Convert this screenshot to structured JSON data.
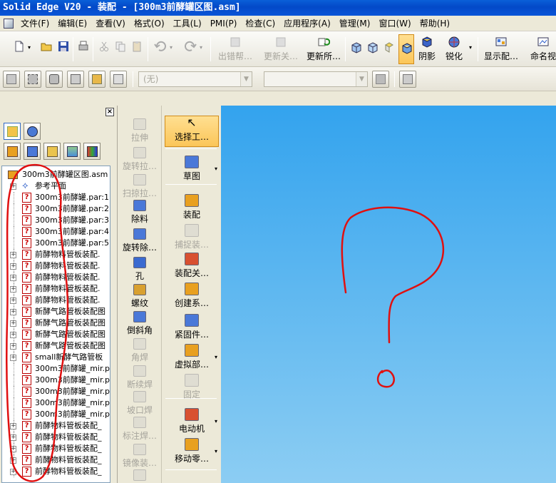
{
  "window": {
    "title": "Solid Edge V20 - 装配 - [300m3前酵罐区图.asm]"
  },
  "menubar": {
    "items": [
      "文件(F)",
      "编辑(E)",
      "查看(V)",
      "格式(O)",
      "工具(L)",
      "PMI(P)",
      "检查(C)",
      "应用程序(A)",
      "管理(M)",
      "窗口(W)",
      "帮助(H)"
    ]
  },
  "toolbar1": {
    "labels": {
      "error_helper": "出错帮…",
      "update_rel": "更新关…",
      "update_all": "更新所…",
      "shadow": "阴影",
      "sharpen": "锐化",
      "show_config": "显示配…",
      "named_views": "命名视"
    }
  },
  "toolbar2": {
    "style_combo_value": "(无)",
    "second_combo_value": ""
  },
  "left_panel": {
    "tree": [
      {
        "label": "300m3前酵罐区图.asm",
        "type": "root"
      },
      {
        "label": "参考平面",
        "type": "planes",
        "expand": true
      },
      {
        "label": "300m3前酵罐.par:1",
        "type": "part"
      },
      {
        "label": "300m3前酵罐.par:2",
        "type": "part"
      },
      {
        "label": "300m3前酵罐.par:3",
        "type": "part"
      },
      {
        "label": "300m3前酵罐.par:4",
        "type": "part"
      },
      {
        "label": "300m3前酵罐.par:5",
        "type": "part"
      },
      {
        "label": "前酵物料管板装配.",
        "type": "asm",
        "expand": true
      },
      {
        "label": "前酵物料管板装配.",
        "type": "asm",
        "expand": true
      },
      {
        "label": "前酵物料管板装配.",
        "type": "asm",
        "expand": true
      },
      {
        "label": "前酵物料管板装配.",
        "type": "asm",
        "expand": true
      },
      {
        "label": "前酵物料管板装配.",
        "type": "asm",
        "expand": true
      },
      {
        "label": "新酵气路管板装配图",
        "type": "asm",
        "expand": true
      },
      {
        "label": "新酵气路管板装配图",
        "type": "asm",
        "expand": true
      },
      {
        "label": "新酵气路管板装配图",
        "type": "asm",
        "expand": true
      },
      {
        "label": "新酵气路管板装配图",
        "type": "asm",
        "expand": true
      },
      {
        "label": "small新酵气路管板",
        "type": "asm",
        "expand": true
      },
      {
        "label": "300m3前酵罐_mir.p",
        "type": "part"
      },
      {
        "label": "300m3前酵罐_mir.p",
        "type": "part"
      },
      {
        "label": "300m3前酵罐_mir.p",
        "type": "part"
      },
      {
        "label": "300m3前酵罐_mir.p",
        "type": "part"
      },
      {
        "label": "300m3前酵罐_mir.p",
        "type": "part"
      },
      {
        "label": "前酵物料管板装配_",
        "type": "asm",
        "expand": true
      },
      {
        "label": "前酵物料管板装配_",
        "type": "asm",
        "expand": true
      },
      {
        "label": "前酵物料管板装配_",
        "type": "asm",
        "expand": true
      },
      {
        "label": "前酵物料管板装配_",
        "type": "asm",
        "expand": true
      },
      {
        "label": "前酵物料管板装配_",
        "type": "asm",
        "expand": true
      }
    ]
  },
  "features_col": {
    "items": [
      {
        "label": "拉伸",
        "enabled": false
      },
      {
        "label": "旋转拉…",
        "enabled": false
      },
      {
        "label": "扫掠拉…",
        "enabled": false
      },
      {
        "label": "除料",
        "enabled": true
      },
      {
        "label": "旋转除…",
        "enabled": true
      },
      {
        "label": "孔",
        "enabled": true
      },
      {
        "label": "螺纹",
        "enabled": true
      },
      {
        "label": "倒斜角",
        "enabled": true
      },
      {
        "label": "角焊",
        "enabled": false
      },
      {
        "label": "断续焊",
        "enabled": false
      },
      {
        "label": "坡口焊",
        "enabled": false
      },
      {
        "label": "标注焊…",
        "enabled": false
      },
      {
        "label": "镜像装…",
        "enabled": false
      },
      {
        "label": "阵列装…",
        "enabled": false
      }
    ]
  },
  "assembly_col": {
    "items": [
      {
        "label": "选择工…",
        "enabled": true,
        "selected": true
      },
      {
        "label": "草图",
        "enabled": true,
        "dropdown": true
      },
      {
        "label": "装配",
        "enabled": true
      },
      {
        "label": "捕捉装…",
        "enabled": false
      },
      {
        "label": "装配关…",
        "enabled": true
      },
      {
        "label": "创建系…",
        "enabled": true
      },
      {
        "label": "紧固件…",
        "enabled": true
      },
      {
        "label": "虚拟部…",
        "enabled": true,
        "dropdown": true
      },
      {
        "label": "固定",
        "enabled": false
      },
      {
        "label": "电动机",
        "enabled": true,
        "dropdown": true
      },
      {
        "label": "移动零…",
        "enabled": true,
        "dropdown": true
      }
    ]
  },
  "colors": {
    "title_bar": "#0349c8",
    "annotation_red": "#e01010",
    "viewport_top": "#33a3ee",
    "viewport_bottom": "#8ccdf3",
    "selected_tool": "#fbc659"
  }
}
